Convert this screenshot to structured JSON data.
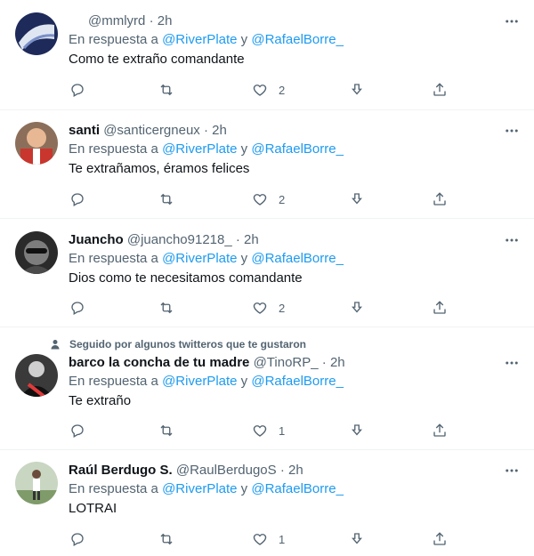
{
  "reply_prefix": "En respuesta a",
  "conjunction": "y",
  "separator": "·",
  "colors": {
    "accent": "#1d9bf0",
    "secondary": "#536471",
    "text": "#0f1419",
    "divider": "#eff3f4"
  },
  "social_context": "Seguido por algunos twitteros que te gustaron",
  "tweets": [
    {
      "name": "",
      "handle": "@mmlyrd",
      "time": "2h",
      "mention1": "@RiverPlate",
      "mention2": "@RafaelBorre_",
      "text": "Como te extraño comandante",
      "likes": "2",
      "icons": [
        "reply-icon",
        "retweet-icon",
        "like-icon",
        "share-icon",
        "upload-icon"
      ]
    },
    {
      "name": "santi",
      "handle": "@santicergneux",
      "time": "2h",
      "mention1": "@RiverPlate",
      "mention2": "@RafaelBorre_",
      "text": "Te extrañamos, éramos felices",
      "likes": "2"
    },
    {
      "name": "Juancho",
      "handle": "@juancho91218_",
      "time": "2h",
      "mention1": "@RiverPlate",
      "mention2": "@RafaelBorre_",
      "text": "Dios como te necesitamos comandante",
      "likes": "2"
    },
    {
      "name": "barco la concha de tu madre",
      "handle": "@TinoRP_",
      "time": "2h",
      "mention1": "@RiverPlate",
      "mention2": "@RafaelBorre_",
      "text": "Te extraño",
      "likes": "1"
    },
    {
      "name": "Raúl Berdugo S.",
      "handle": "@RaulBerdugoS",
      "time": "2h",
      "mention1": "@RiverPlate",
      "mention2": "@RafaelBorre_",
      "text": "LOTRAI",
      "likes": "1"
    }
  ]
}
